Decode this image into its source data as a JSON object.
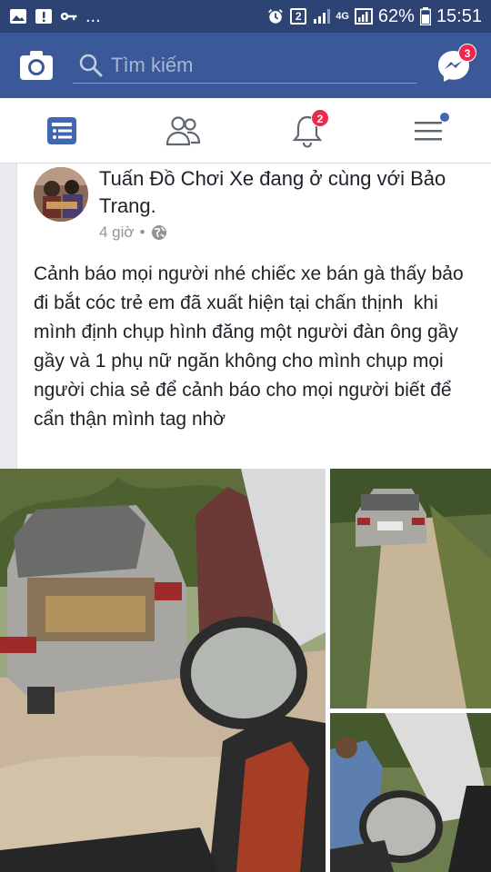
{
  "status_bar": {
    "ellipsis": "...",
    "sim_badge": "2",
    "network": "4G",
    "battery_percent": "62%",
    "time": "15:51"
  },
  "topbar": {
    "search_placeholder": "Tìm kiếm",
    "messenger_badge": "3"
  },
  "navbar": {
    "notifications_badge": "2"
  },
  "post": {
    "header_line": "Tuấn Đồ Chơi Xe đang ở cùng với Bảo Trang.",
    "time": "4 giờ",
    "separator": "•",
    "privacy": "public",
    "body": "Cảnh báo mọi người nhé chiếc xe bán gà thấy bảo đi bắt cóc trẻ em đã xuất hiện tại chấn thịnh  khi mình định chụp hình đăng một người đàn ông gầy gầy và 1 phụ nữ ngăn không cho mình chụp mọi người chia sẻ để cảnh báo cho mọi người biết để cẩn thận mình tag nhờ"
  },
  "colors": {
    "status_bar": "#2d4373",
    "topbar": "#3b5998",
    "active_nav": "#4267b2",
    "badge": "#f02849"
  },
  "icons": [
    "camera-icon",
    "search-icon",
    "messenger-icon",
    "news-feed-icon",
    "friends-icon",
    "bell-icon",
    "menu-icon",
    "globe-icon"
  ]
}
